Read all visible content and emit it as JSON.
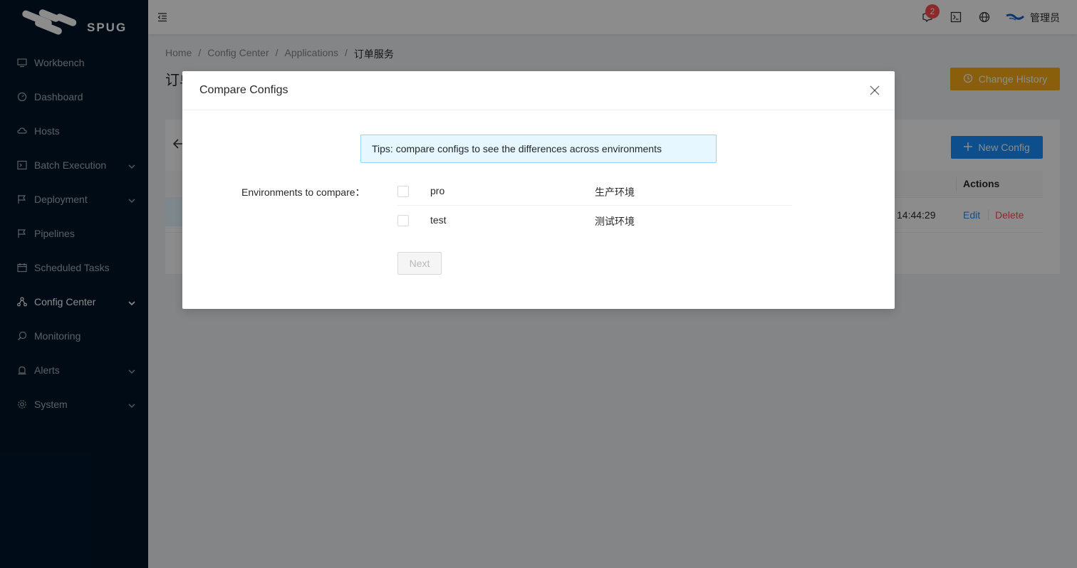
{
  "brand": {
    "logo_text": "SPUG"
  },
  "sidebar": {
    "items": [
      {
        "label": "Workbench",
        "icon": "desktop-icon"
      },
      {
        "label": "Dashboard",
        "icon": "dashboard-icon"
      },
      {
        "label": "Hosts",
        "icon": "cloud-server-icon"
      },
      {
        "label": "Batch Execution",
        "icon": "code-icon",
        "expandable": true
      },
      {
        "label": "Deployment",
        "icon": "flag-icon",
        "expandable": true
      },
      {
        "label": "Pipelines",
        "icon": "flag-icon"
      },
      {
        "label": "Scheduled Tasks",
        "icon": "schedule-icon"
      },
      {
        "label": "Config Center",
        "icon": "apartment-icon",
        "expandable": true,
        "active": true
      },
      {
        "label": "Monitoring",
        "icon": "monitor-icon"
      },
      {
        "label": "Alerts",
        "icon": "alert-icon",
        "expandable": true
      },
      {
        "label": "System",
        "icon": "setting-icon",
        "expandable": true
      }
    ]
  },
  "header": {
    "notification_count": "2",
    "user_name": "管理员"
  },
  "breadcrumb": [
    "Home",
    "Config Center",
    "Applications",
    "订单服务"
  ],
  "page": {
    "title": "订单服务",
    "change_history_label": "Change History",
    "new_config_label": "New Config",
    "table": {
      "actions_header": "Actions",
      "row": {
        "time": "14:44:29",
        "edit": "Edit",
        "delete": "Delete"
      }
    }
  },
  "modal": {
    "title": "Compare Configs",
    "tips": "Tips: compare configs to see the differences across environments",
    "form_label": "Environments to compare：",
    "environments": [
      {
        "key": "pro",
        "name": "生产环境",
        "checked": false
      },
      {
        "key": "test",
        "name": "测试环境",
        "checked": false
      }
    ],
    "next_label": "Next"
  },
  "colors": {
    "sidebar_bg": "#001529",
    "primary": "#1890ff",
    "warning": "#faad14",
    "danger": "#ff4d4f"
  }
}
